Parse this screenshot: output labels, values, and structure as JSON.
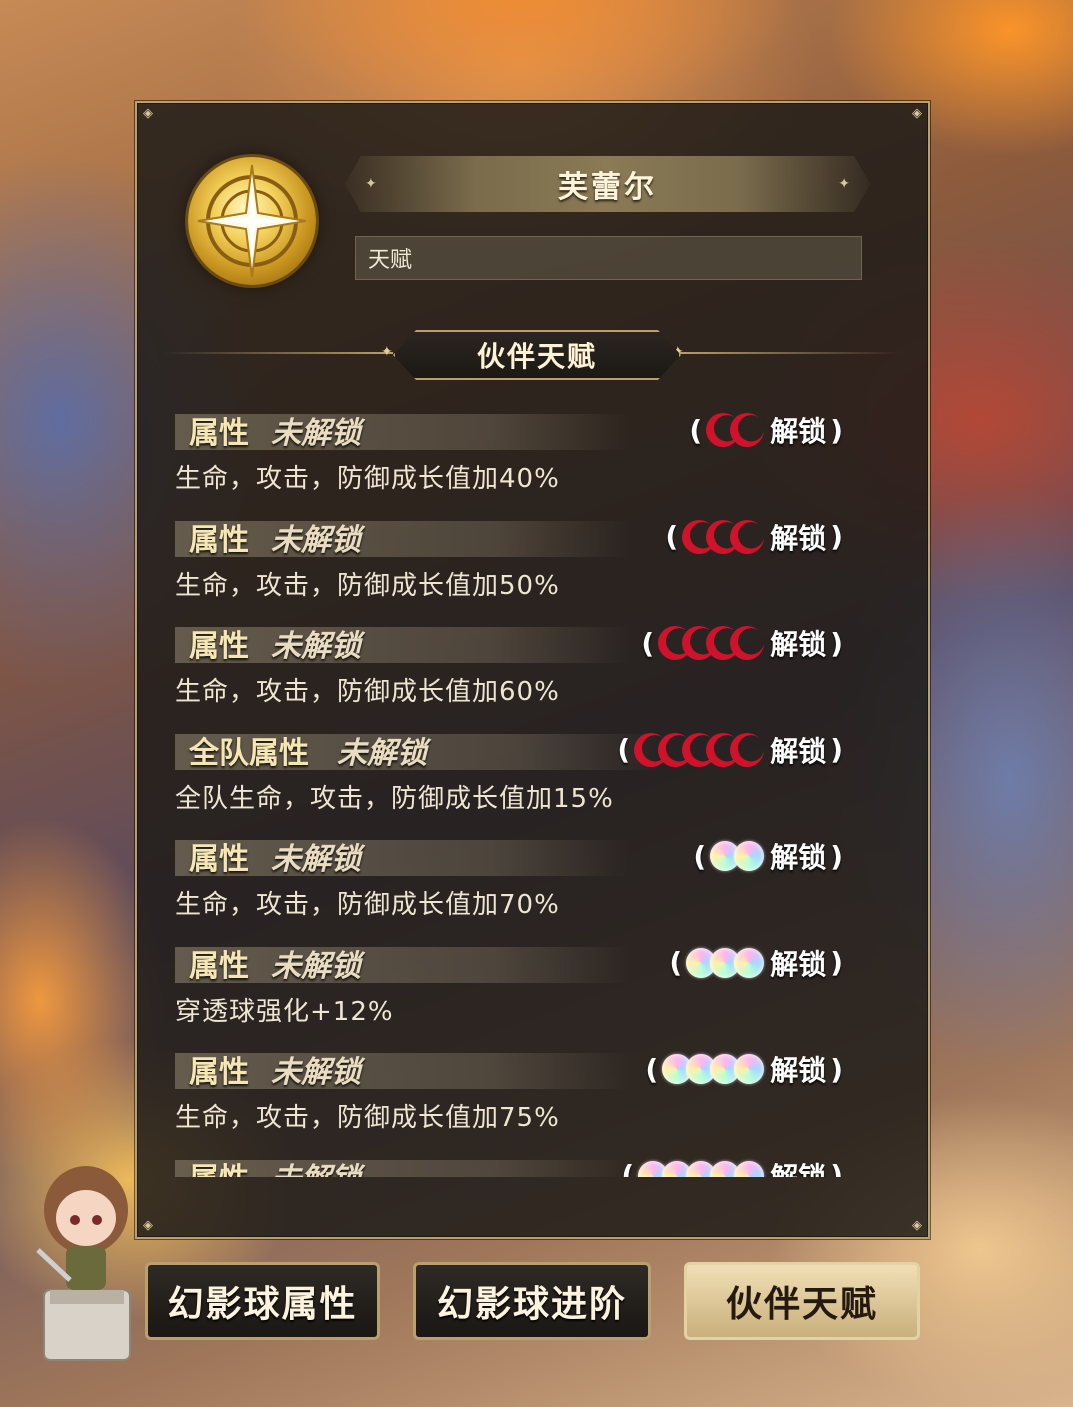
{
  "character": {
    "name": "芙蕾尔",
    "subtitle": "天赋"
  },
  "section_title": "伙伴天赋",
  "talents": [
    {
      "type": "属性",
      "status": "未解锁",
      "desc": "生命，攻击，防御成长值加40%",
      "req_icon": "red-moon-icon",
      "req_count": 2,
      "req_label": "解锁"
    },
    {
      "type": "属性",
      "status": "未解锁",
      "desc": "生命，攻击，防御成长值加50%",
      "req_icon": "red-moon-icon",
      "req_count": 3,
      "req_label": "解锁"
    },
    {
      "type": "属性",
      "status": "未解锁",
      "desc": "生命，攻击，防御成长值加60%",
      "req_icon": "red-moon-icon",
      "req_count": 4,
      "req_label": "解锁"
    },
    {
      "type": "全队属性",
      "status": "未解锁",
      "desc": "全队生命，攻击，防御成长值加15%",
      "req_icon": "red-moon-icon",
      "req_count": 5,
      "req_label": "解锁"
    },
    {
      "type": "属性",
      "status": "未解锁",
      "desc": "生命，攻击，防御成长值加70%",
      "req_icon": "rainbow-gem-icon",
      "req_count": 2,
      "req_label": "解锁"
    },
    {
      "type": "属性",
      "status": "未解锁",
      "desc": "穿透球强化+12%",
      "req_icon": "rainbow-gem-icon",
      "req_count": 3,
      "req_label": "解锁"
    },
    {
      "type": "属性",
      "status": "未解锁",
      "desc": "生命，攻击，防御成长值加75%",
      "req_icon": "rainbow-gem-icon",
      "req_count": 4,
      "req_label": "解锁"
    },
    {
      "type": "属性",
      "status": "未解锁",
      "desc": "",
      "req_icon": "rainbow-gem-icon",
      "req_count": 5,
      "req_label": "解锁"
    }
  ],
  "paren_open": "(",
  "paren_close": ")",
  "tabs": [
    {
      "label": "幻影球属性",
      "active": false
    },
    {
      "label": "幻影球进阶",
      "active": false
    },
    {
      "label": "伙伴天赋",
      "active": true
    }
  ],
  "colors": {
    "panel_border": "#b9a06e",
    "attr_text": "#f5e6b4",
    "moon_red": "#d0122a",
    "active_tab_bg": "#e6d3a6"
  }
}
